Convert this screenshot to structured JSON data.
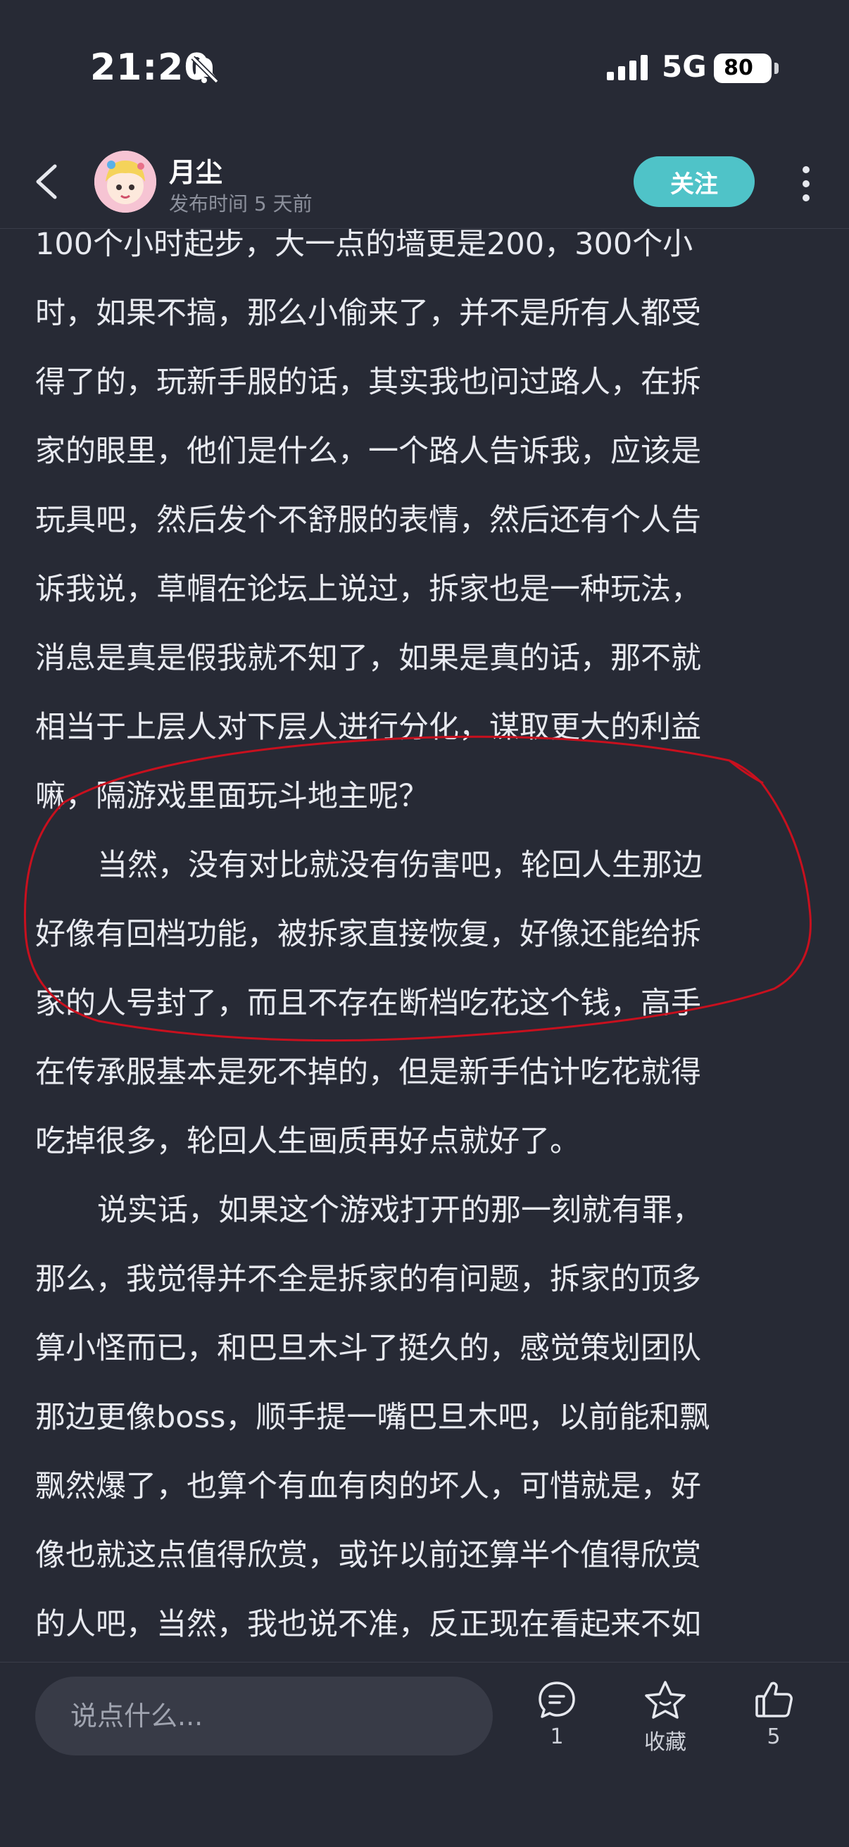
{
  "status_bar": {
    "time": "21:20",
    "network": "5G",
    "battery": "80"
  },
  "header": {
    "author": "月尘",
    "meta": "发布时间 5 天前",
    "follow_label": "关注"
  },
  "article": {
    "lines": [
      "100个小时起步，大一点的墙更是200，300个小",
      "时，如果不搞，那么小偷来了，并不是所有人都受",
      "得了的，玩新手服的话，其实我也问过路人，在拆",
      "家的眼里，他们是什么，一个路人告诉我，应该是",
      "玩具吧，然后发个不舒服的表情，然后还有个人告",
      "诉我说，草帽在论坛上说过，拆家也是一种玩法，",
      "消息是真是假我就不知了，如果是真的话，那不就",
      "相当于上层人对下层人进行分化，谋取更大的利益",
      "嘛，隔游戏里面玩斗地主呢？",
      "当然，没有对比就没有伤害吧，轮回人生那边",
      "好像有回档功能，被拆家直接恢复，好像还能给拆",
      "家的人号封了，而且不存在断档吃花这个钱，高手",
      "在传承服基本是死不掉的，但是新手估计吃花就得",
      "吃掉很多，轮回人生画质再好点就好了。",
      "说实话，如果这个游戏打开的那一刻就有罪，",
      "那么，我觉得并不全是拆家的有问题，拆家的顶多",
      "算小怪而已，和巴旦木斗了挺久的，感觉策划团队",
      "那边更像boss，顺手提一嘴巴旦木吧，以前能和飘",
      "飘然爆了，也算个有血有肉的坏人，可惜就是，好",
      "像也就这点值得欣赏，或许以前还算半个值得欣赏",
      "的人吧，当然，我也说不准，反正现在看起来不如"
    ]
  },
  "bottom_bar": {
    "comment_placeholder": "说点什么...",
    "comment_count": "1",
    "favorite_label": "收藏",
    "like_count": "5"
  },
  "colors": {
    "background": "#272a35",
    "accent": "#4fc3c8",
    "annotation": "#c8101e"
  }
}
